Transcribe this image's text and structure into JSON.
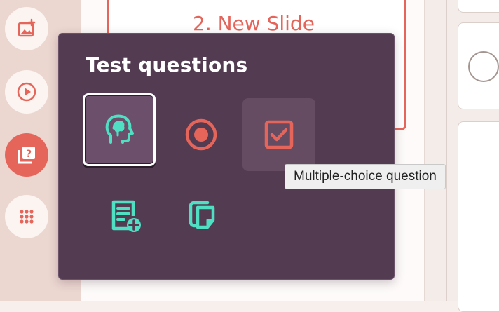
{
  "slide": {
    "title": "2. New Slide"
  },
  "popup": {
    "title": "Test questions",
    "tooltip": "Multiple-choice question"
  },
  "colors": {
    "accent": "#e5655a",
    "popup_bg": "#533b52",
    "teal_icon": "#4fe0c4"
  },
  "sidebar": {
    "items": [
      {
        "icon": "image-add-icon"
      },
      {
        "icon": "play-icon"
      },
      {
        "icon": "quiz-icon",
        "active": true
      },
      {
        "icon": "apps-grid-icon"
      }
    ]
  },
  "questions": [
    {
      "icon": "head-brain-icon",
      "selected": true
    },
    {
      "icon": "radio-button-icon"
    },
    {
      "icon": "checkbox-icon",
      "hover": true
    },
    {
      "icon": "document-add-icon"
    },
    {
      "icon": "copy-notes-icon"
    }
  ]
}
